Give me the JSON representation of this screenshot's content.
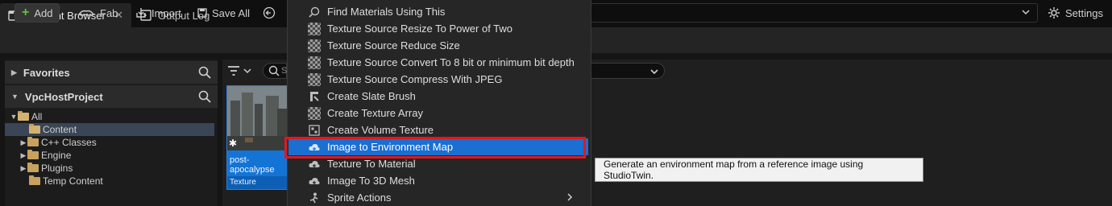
{
  "tabs": {
    "content_browser": "Content Browser",
    "output_log": "Output Log"
  },
  "toolbar": {
    "add_label": "Add",
    "fab_label": "Fab",
    "import_label": "Import",
    "save_all_label": "Save All",
    "settings_label": "Settings"
  },
  "left_panel": {
    "favorites_label": "Favorites",
    "project_label": "VpcHostProject",
    "tree": [
      {
        "label": "All"
      },
      {
        "label": "Content"
      },
      {
        "label": "C++ Classes"
      },
      {
        "label": "Engine"
      },
      {
        "label": "Plugins"
      },
      {
        "label": "Temp Content"
      }
    ]
  },
  "search": {
    "placeholder": "S"
  },
  "asset": {
    "name": "post-apocalypse",
    "type": "Texture"
  },
  "context_menu": {
    "items": [
      {
        "label": "Find Materials Using This",
        "icon": "search-materials-icon"
      },
      {
        "label": "Texture Source Resize To Power of Two",
        "icon": "texture-icon"
      },
      {
        "label": "Texture Source Reduce Size",
        "icon": "texture-icon"
      },
      {
        "label": "Texture Source Convert To 8 bit or minimum bit depth",
        "icon": "texture-icon"
      },
      {
        "label": "Texture Source Compress With JPEG",
        "icon": "texture-icon"
      },
      {
        "label": "Create Slate Brush",
        "icon": "brush-icon"
      },
      {
        "label": "Create Texture Array",
        "icon": "texture-icon"
      },
      {
        "label": "Create Volume Texture",
        "icon": "volume-texture-icon"
      },
      {
        "label": "Image to Environment Map",
        "icon": "cloud-icon"
      },
      {
        "label": "Texture To Material",
        "icon": "cloud-icon"
      },
      {
        "label": "Image To 3D Mesh",
        "icon": "cloud-icon"
      },
      {
        "label": "Sprite Actions",
        "icon": "sprite-icon"
      }
    ]
  },
  "tooltip": {
    "text": "Generate an environment map from a reference image using StudioTwin."
  },
  "colors": {
    "highlight": "#1a6fd1",
    "annotation_box": "#e1171e",
    "selection": "#1474d6"
  }
}
